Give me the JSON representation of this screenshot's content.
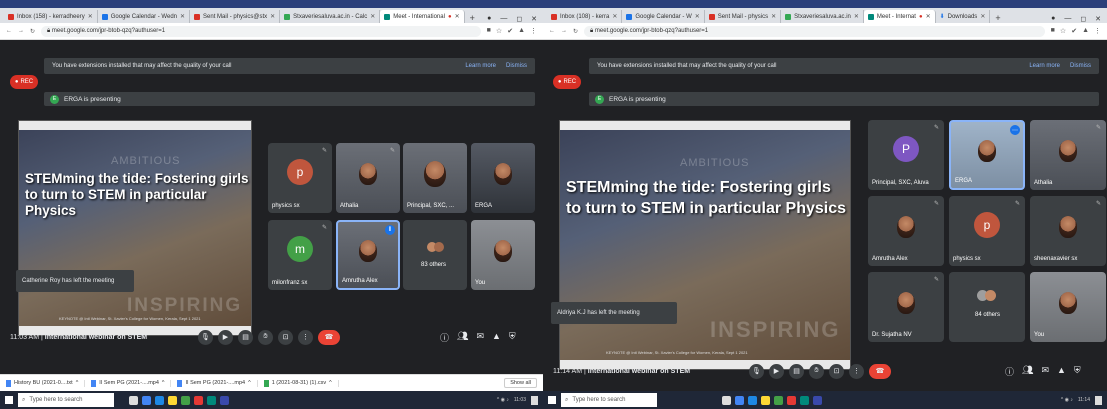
{
  "left": {
    "tabs": [
      {
        "label": "Inbox (158) - kerradheery",
        "color": "#d93025"
      },
      {
        "label": "Google Calendar - Wedn",
        "color": "#1a73e8"
      },
      {
        "label": "Sent Mail - physics@stx",
        "color": "#d93025"
      },
      {
        "label": "Stxaveriesaluva.ac.in - Calc",
        "color": "#34a853"
      },
      {
        "label": "Meet - International",
        "color": "#00897b",
        "active": true
      }
    ],
    "url": "meet.google.com/jpr-btob-qzq?authuser=1",
    "ext_msg": "You have extensions installed that may affect the quality of your call",
    "learn_more": "Learn more",
    "dismiss": "Dismiss",
    "rec": "REC",
    "presenter_initial": "E",
    "presenting": "ERGA is presenting",
    "slide": {
      "amb": "AMBITIOUS",
      "title": "STEMming the tide:  Fostering girls to turn to STEM in particular Physics",
      "insp": "INSPIRING",
      "foot": "KEYNOTE @ Intl Webinar, St. Xavier's College for Women, Kerala, Sept 1 2021"
    },
    "tiles": [
      {
        "name": "physics sx",
        "initial": "p",
        "color": "#c0563d"
      },
      {
        "name": "Athalia",
        "video": true
      },
      {
        "name": "Principal, SXC, ...",
        "video": true
      },
      {
        "name": "ERGA",
        "video": true
      },
      {
        "name": "milonfranz sx",
        "initial": "m",
        "color": "#43a047"
      },
      {
        "name": "Amrutha Alex",
        "video": true,
        "hl": true
      },
      {
        "name": "83 others",
        "others": true
      },
      {
        "name": "You",
        "video": true
      }
    ],
    "toast": "Catherine Roy has left the meeting",
    "time": "11:03 AM",
    "meeting": "International webinar on STEM",
    "downloads": [
      "History BU (2021-0....txt",
      "II Sem PG (2021-....mp4",
      "II Sem PG (2021-....mp4",
      "1 (2021-08-31) (1).csv"
    ],
    "show_all": "Show all",
    "search": "Type here to search",
    "clock": "11:03"
  },
  "right": {
    "tabs": [
      {
        "label": "Inbox (108) - kerra",
        "color": "#d93025"
      },
      {
        "label": "Google Calendar - W",
        "color": "#1a73e8"
      },
      {
        "label": "Sent Mail - physics",
        "color": "#d93025"
      },
      {
        "label": "Stxaveriesaluva.ac.in",
        "color": "#34a853"
      },
      {
        "label": "Meet - Internat",
        "color": "#00897b",
        "active": true
      },
      {
        "label": "Downloads",
        "color": "#1a73e8"
      }
    ],
    "url": "meet.google.com/jpr-btob-qzq?authuser=1",
    "ext_msg": "You have extensions installed that may affect the quality of your call",
    "learn_more": "Learn more",
    "dismiss": "Dismiss",
    "rec": "REC",
    "presenter_initial": "E",
    "presenting": "ERGA is presenting",
    "slide": {
      "amb": "AMBITIOUS",
      "title": "STEMming the tide:  Fostering girls to turn to STEM in particular Physics",
      "insp": "INSPIRING",
      "foot": "KEYNOTE @ Intl Webinar, St. Xavier's College for Women, Kerala, Sept 1 2021"
    },
    "tiles": [
      {
        "name": "Principal, SXC, Aluva",
        "initial": "P",
        "color": "#7e57c2"
      },
      {
        "name": "ERGA",
        "video": true,
        "hl": true
      },
      {
        "name": "Athalia",
        "video": true
      },
      {
        "name": "Amrutha Alex",
        "video": true
      },
      {
        "name": "physics sx",
        "initial": "p",
        "color": "#c0563d"
      },
      {
        "name": "sheenaxavier sx",
        "video": true
      },
      {
        "name": "Dr. Sujatha NV",
        "video": true
      },
      {
        "name": "84 others",
        "others": true
      },
      {
        "name": "You",
        "video": true
      }
    ],
    "toast": "Aldriya K.J has left the meeting",
    "time": "11:14 AM",
    "meeting": "International webinar on STEM",
    "search": "Type here to search",
    "clock": "11:14"
  }
}
